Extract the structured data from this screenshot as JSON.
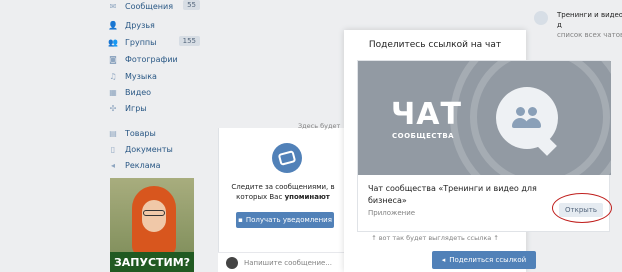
{
  "sidebar": {
    "items": [
      {
        "label": "Сообщения",
        "icon": "message-icon",
        "count": "55"
      },
      {
        "label": "Друзья",
        "icon": "person-icon"
      },
      {
        "label": "Группы",
        "icon": "group-icon",
        "count": "155"
      },
      {
        "label": "Фотографии",
        "icon": "camera-icon"
      },
      {
        "label": "Музыка",
        "icon": "music-note-icon"
      },
      {
        "label": "Видео",
        "icon": "film-icon"
      },
      {
        "label": "Игры",
        "icon": "gamepad-icon"
      },
      {
        "label": "Товары",
        "icon": "shop-icon"
      },
      {
        "label": "Документы",
        "icon": "document-icon"
      },
      {
        "label": "Реклама",
        "icon": "megaphone-icon"
      }
    ]
  },
  "ad": {
    "banner": "ЗАПУСТИМ?"
  },
  "middle": {
    "top_hint": "Здесь будет",
    "notify_text_1": "Следите за сообщениями, в",
    "notify_text_2": "которых Вас",
    "notify_text_bold": "упоминают",
    "notify_button": "Получать уведомления",
    "composer_placeholder": "Напишите сообщение..."
  },
  "modal": {
    "title": "Поделитесь ссылкой на чат",
    "hero_big": "ЧАТ",
    "hero_sub": "СООБЩЕСТВА",
    "card_title": "Чат сообщества «Тренинги и видео для бизнеса»",
    "card_meta": "Приложение",
    "open_button": "Открыть",
    "hint": "↑ вот так будет выглядеть ссылка ↑",
    "share_button": "Поделиться ссылкой"
  },
  "notification": {
    "title": "Тренинги и видео д",
    "subtitle": "список всех чатов"
  },
  "colors": {
    "accent": "#5181b8",
    "annotation": "#c0201e"
  }
}
